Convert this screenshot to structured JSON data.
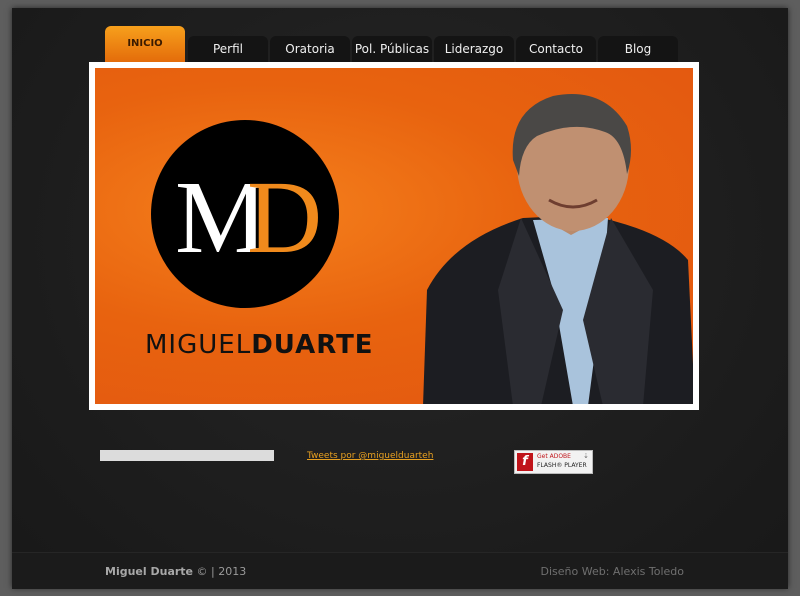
{
  "nav": {
    "tabs": [
      {
        "label": "INICIO"
      },
      {
        "label": "Perfil"
      },
      {
        "label": "Oratoria"
      },
      {
        "label": "Pol. Públicas"
      },
      {
        "label": "Liderazgo"
      },
      {
        "label": "Contacto"
      },
      {
        "label": "Blog"
      }
    ]
  },
  "banner": {
    "monogram_m": "M",
    "monogram_d": "D",
    "brand_first": "MIGUEL",
    "brand_last": "DUARTE"
  },
  "widgets": {
    "tweets_link": "Tweets por @miguelduarteh",
    "flash_line1_a": "Get ",
    "flash_line1_b": "ADOBE",
    "flash_line2": "FLASH® PLAYER"
  },
  "footer": {
    "owner": "Miguel Duarte",
    "copyright": " © | 2013",
    "credit": "Diseño Web:  Alexis Toledo"
  },
  "colors": {
    "accent_orange": "#e8630f",
    "tab_active": "#f39418",
    "link": "#e8a020"
  }
}
